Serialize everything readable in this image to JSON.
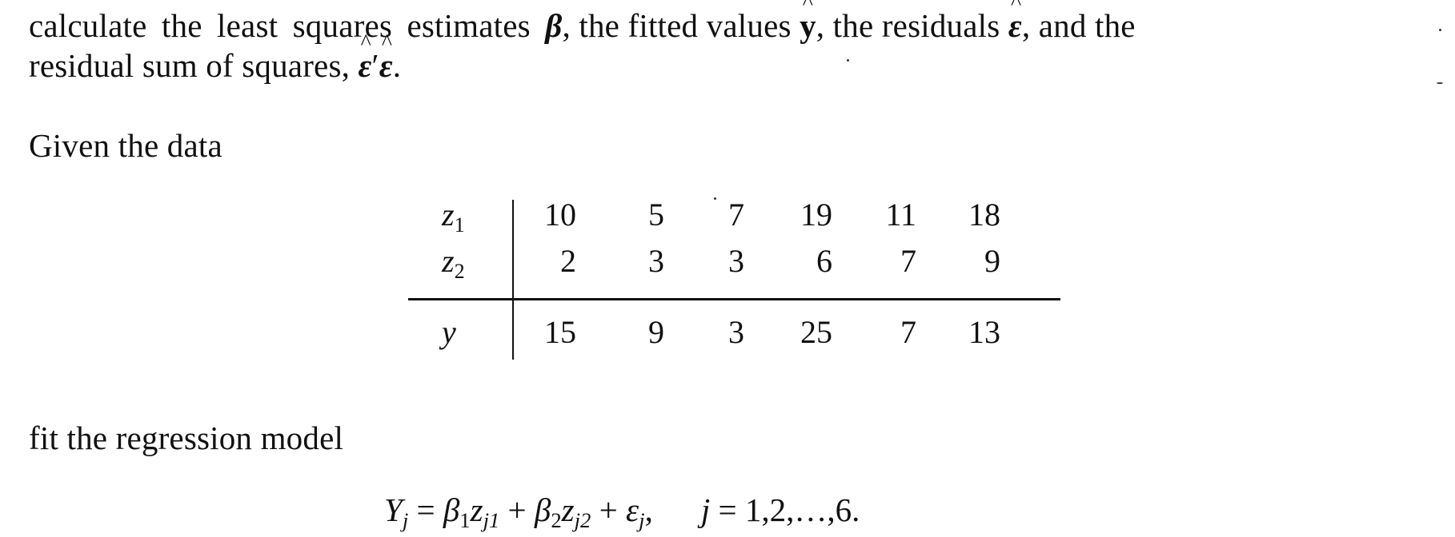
{
  "paragraph": {
    "line1_a": "calculate the least squares estimates ",
    "beta_symbol": "β",
    "line1_b": ", the fitted values ",
    "yhat_symbol": "y",
    "line1_c": ", the residuals ",
    "eps_symbol": "ε",
    "line1_d": ", and the",
    "line2_a": "residual sum of squares, ",
    "rss_eps1": "ε",
    "rss_prime": "′",
    "rss_eps2": "ε",
    "line2_end": "."
  },
  "given_label": "Given the data",
  "table": {
    "rows": [
      {
        "label": "z",
        "sub": "1",
        "values": [
          "10",
          "5",
          "7",
          "19",
          "11",
          "18"
        ]
      },
      {
        "label": "z",
        "sub": "2",
        "values": [
          "2",
          "3",
          "3",
          "6",
          "7",
          "9"
        ]
      },
      {
        "label": "y",
        "sub": "",
        "values": [
          "15",
          "9",
          "3",
          "25",
          "7",
          "13"
        ]
      }
    ]
  },
  "fit_label": "fit the regression model",
  "equation": {
    "Y": "Y",
    "j": "j",
    "eq": " = ",
    "b1": "β",
    "s1": "1",
    "z1": "z",
    "z1sub": "j1",
    "plus": " + ",
    "b2": "β",
    "s2": "2",
    "z2": "z",
    "z2sub": "j2",
    "eps": "ε",
    "epssub": "j",
    "comma": ",",
    "index_var": "j",
    "range": " = 1,2,…,6."
  }
}
